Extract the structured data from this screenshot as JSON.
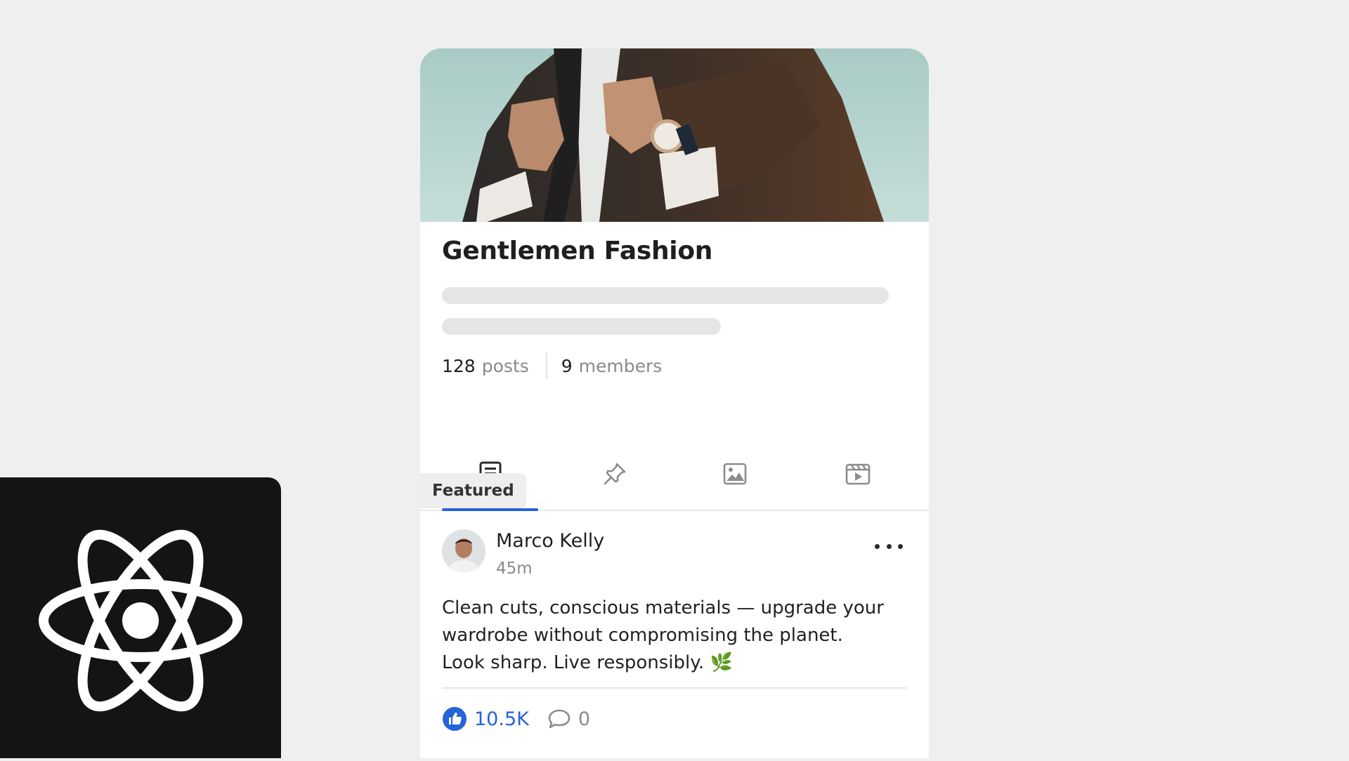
{
  "group": {
    "title": "Gentlemen Fashion",
    "posts_count": "128",
    "posts_label": "posts",
    "members_count": "9",
    "members_label": "members"
  },
  "tabs": [
    {
      "icon": "document-icon",
      "active": true
    },
    {
      "icon": "pin-icon",
      "active": false
    },
    {
      "icon": "image-icon",
      "active": false
    },
    {
      "icon": "video-icon",
      "active": false
    }
  ],
  "post": {
    "badge": "Featured",
    "author": "Marco Kelly",
    "time": "45m",
    "text_lines": [
      "Clean cuts, conscious materials — upgrade your",
      "wardrobe without compromising the planet.",
      "Look sharp. Live responsibly. 🌿"
    ],
    "likes": "10.5K",
    "comments": "0"
  },
  "colors": {
    "accent": "#2563d9",
    "background": "#efefef",
    "logo_bg": "#141414"
  }
}
